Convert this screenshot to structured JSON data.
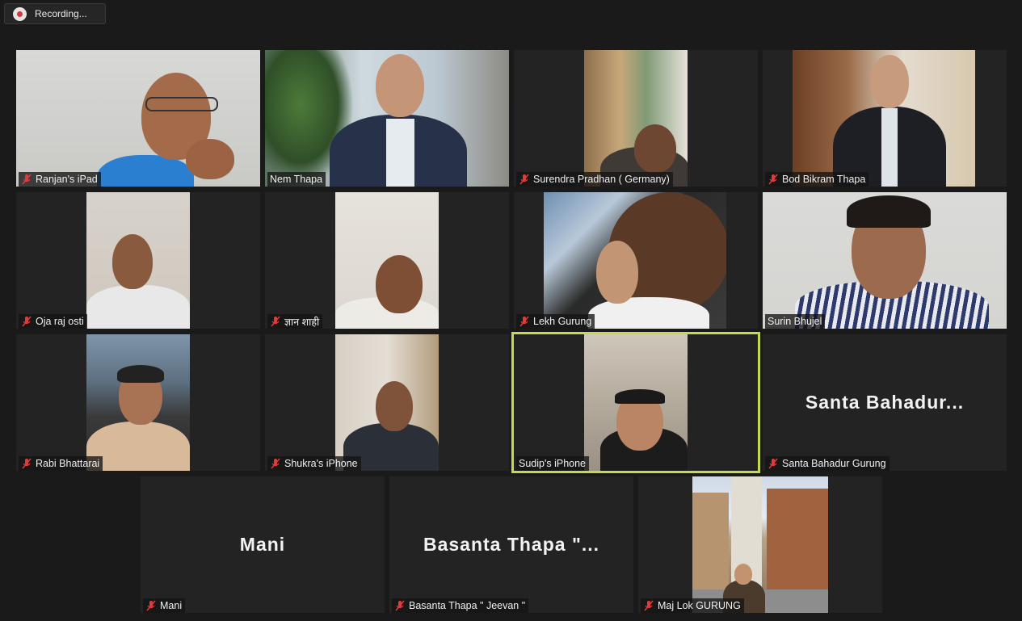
{
  "recording": {
    "label": "Recording..."
  },
  "participants": [
    {
      "name": "Ranjan's iPad",
      "muted": true
    },
    {
      "name": "Nem Thapa",
      "muted": false
    },
    {
      "name": "Surendra Pradhan ( Germany)",
      "muted": true
    },
    {
      "name": "Bod Bikram Thapa",
      "muted": true
    },
    {
      "name": "Oja raj osti",
      "muted": true
    },
    {
      "name": "ज्ञान शाही",
      "muted": true
    },
    {
      "name": "Lekh Gurung",
      "muted": true
    },
    {
      "name": "Surin Bhujel",
      "muted": false
    },
    {
      "name": "Rabi Bhattarai",
      "muted": true
    },
    {
      "name": "Shukra's iPhone",
      "muted": true
    },
    {
      "name": "Sudip's iPhone",
      "muted": false,
      "active_speaker": true
    },
    {
      "name": "Santa Bahadur Gurung",
      "muted": true,
      "display_name": "Santa  Bahadur...",
      "video": false
    },
    {
      "name": "Mani",
      "muted": true,
      "display_name": "Mani",
      "video": false
    },
    {
      "name": "Basanta Thapa \" Jeevan \"",
      "muted": true,
      "display_name": "Basanta  Thapa  \"...",
      "video": false
    },
    {
      "name": "Maj Lok GURUNG",
      "muted": true
    }
  ],
  "colors": {
    "active_speaker_border": "#c3d94f",
    "mute_icon": "#e03b3b",
    "tile_bg": "#232323",
    "background": "#1a1a1a"
  }
}
